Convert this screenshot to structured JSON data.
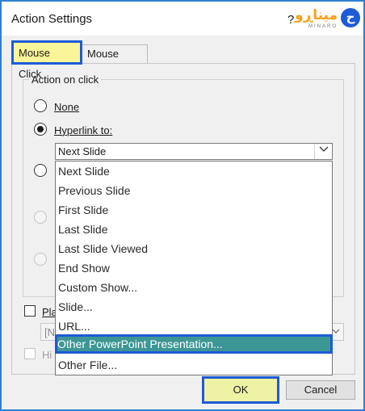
{
  "window": {
    "title": "Action Settings",
    "help": "?"
  },
  "logo": {
    "text": "میناڕو",
    "subtitle": "MINARO",
    "badge": "ح"
  },
  "tabs": [
    {
      "label": "Mouse Click",
      "selected": true
    },
    {
      "label": "Mouse Over",
      "selected": false
    }
  ],
  "group": {
    "label": "Action on click"
  },
  "options": {
    "none": {
      "label": "None",
      "checked": false
    },
    "hyperlink": {
      "label": "Hyperlink to:",
      "checked": true
    }
  },
  "hyperlink_combo": {
    "value": "Next Slide",
    "arrow_icon": "chevron-down-icon"
  },
  "dropdown": {
    "items": [
      "Next Slide",
      "Previous Slide",
      "First Slide",
      "Last Slide",
      "Last Slide Viewed",
      "End Show",
      "Custom Show...",
      "Slide...",
      "URL...",
      "Other PowerPoint Presentation...",
      "Other File..."
    ],
    "selected_index": 9
  },
  "play_sound": {
    "label_partial": "Pla",
    "checked": false
  },
  "sound_select": {
    "value_partial": "[N"
  },
  "highlight": {
    "label_partial": "Hi",
    "checked": false
  },
  "buttons": {
    "ok": "OK",
    "cancel": "Cancel"
  },
  "colors": {
    "highlight_tab": "#fbf59a",
    "selection": "#3d9696",
    "accent_border": "#1e5bd6"
  }
}
